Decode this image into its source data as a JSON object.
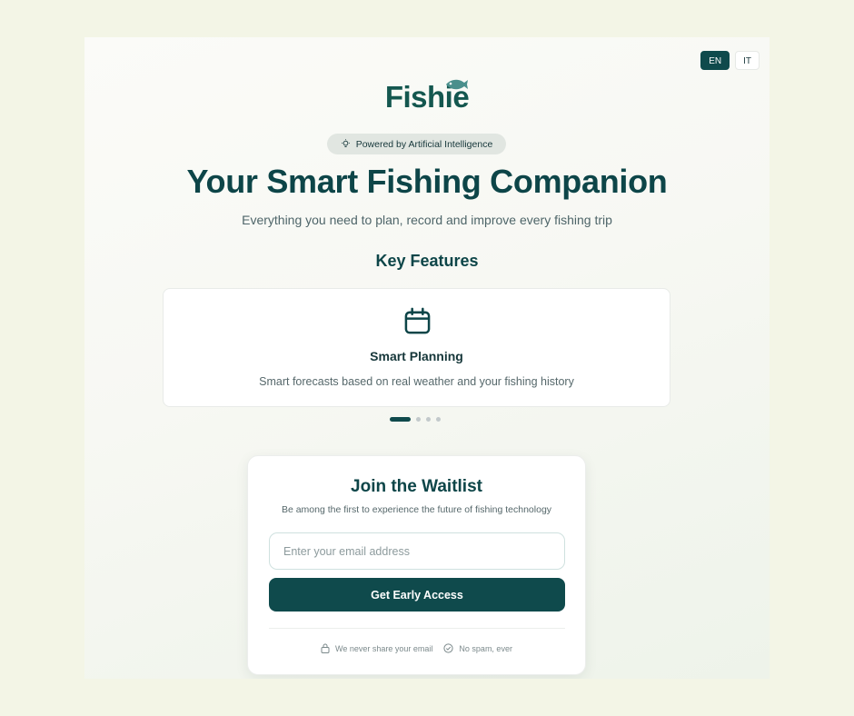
{
  "language_switch": {
    "options": [
      {
        "label": "EN",
        "active": true
      },
      {
        "label": "IT",
        "active": false
      }
    ]
  },
  "brand": {
    "logo_text": "Fishie",
    "color": "#14574f",
    "icon": "fish-icon"
  },
  "hero": {
    "badge_label": "Powered by Artificial Intelligence",
    "badge_icon": "lightbulb-icon",
    "headline": "Your Smart Fishing Companion",
    "subheadline": "Everything you need to plan, record and improve every fishing trip"
  },
  "features": {
    "title": "Key Features",
    "active_card": {
      "icon": "calendar-icon",
      "title": "Smart Planning",
      "description": "Smart forecasts based on real weather and your fishing history"
    },
    "carousel": {
      "total_slides": 4,
      "active_index": 0
    }
  },
  "waitlist": {
    "title": "Join the Waitlist",
    "subtitle": "Be among the first to experience the future of fishing technology",
    "email_placeholder": "Enter your email address",
    "email_value": "",
    "submit_label": "Get Early Access",
    "notes": [
      {
        "icon": "lock-icon",
        "text": "We never share your email"
      },
      {
        "icon": "check-circle-icon",
        "text": "No spam, ever"
      }
    ]
  },
  "colors": {
    "primary": "#0f4a4c",
    "background": "#f3f5e6"
  }
}
